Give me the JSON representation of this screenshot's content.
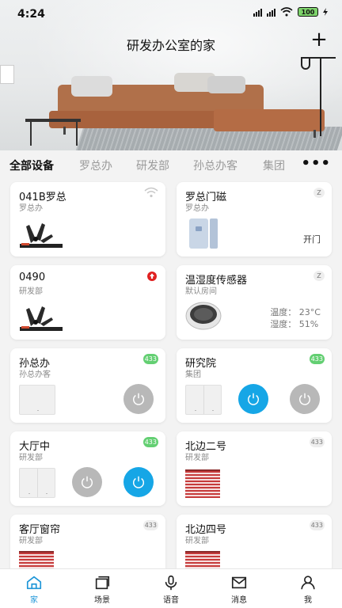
{
  "status_bar": {
    "time": "4:24",
    "battery": "100"
  },
  "header": {
    "title": "研发办公室的家",
    "add_symbol": "+"
  },
  "tabs": [
    {
      "label": "全部设备",
      "active": true
    },
    {
      "label": "罗总办"
    },
    {
      "label": "研发部"
    },
    {
      "label": "孙总办客"
    },
    {
      "label": "集团"
    }
  ],
  "more_symbol": "•••",
  "devices": [
    {
      "name": "041B罗总",
      "room": "罗总办",
      "protocol": "wifi"
    },
    {
      "name": "罗总门磁",
      "room": "罗总办",
      "protocol": "Z",
      "status": "开门"
    },
    {
      "name": "0490",
      "room": "研发部",
      "protocol": "alert"
    },
    {
      "name": "温湿度传感器",
      "room": "默认房间",
      "protocol": "Z",
      "temperature": "温度：  23°C",
      "humidity": "湿度：  51%"
    },
    {
      "name": "孙总办",
      "room": "孙总办客",
      "protocol": "433"
    },
    {
      "name": "研究院",
      "room": "集团",
      "protocol": "433"
    },
    {
      "name": "大厅中",
      "room": "研发部",
      "protocol": "433"
    },
    {
      "name": "北边二号",
      "room": "研发部",
      "protocol": "433"
    },
    {
      "name": "客厅窗帘",
      "room": "研发部",
      "protocol": "433"
    },
    {
      "name": "北边四号",
      "room": "研发部",
      "protocol": "433"
    }
  ],
  "nav": [
    {
      "label": "家",
      "icon": "home-icon",
      "active": true
    },
    {
      "label": "场景",
      "icon": "scene-icon"
    },
    {
      "label": "语音",
      "icon": "microphone-icon"
    },
    {
      "label": "消息",
      "icon": "message-icon"
    },
    {
      "label": "我",
      "icon": "profile-icon"
    }
  ],
  "colors": {
    "accent": "#1e96d8",
    "power_on": "#16a6e6",
    "power_off": "#b8b8b8",
    "badge_433": "#63cf72",
    "alert": "#e02020",
    "curtain": "#c63b3b"
  }
}
